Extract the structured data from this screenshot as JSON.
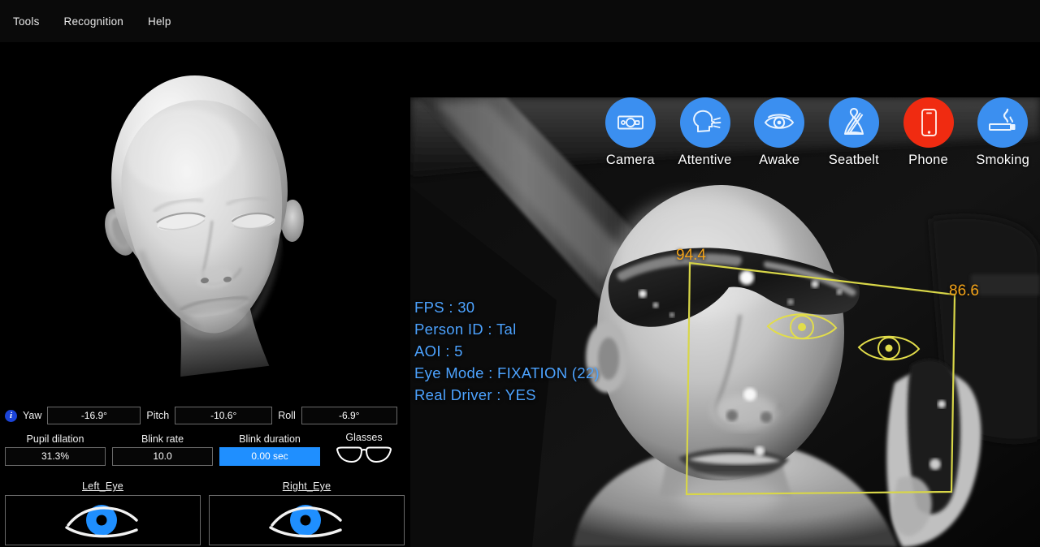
{
  "menu": {
    "items": [
      {
        "label": "Tools",
        "name": "menu-tools"
      },
      {
        "label": "Recognition",
        "name": "menu-recognition"
      },
      {
        "label": "Help",
        "name": "menu-help"
      }
    ]
  },
  "head_model": {
    "title": "3D head pose model",
    "icon": "head-model-3d"
  },
  "pose": {
    "info_icon": "info-icon",
    "info_glyph": "i",
    "yaw_label": "Yaw",
    "yaw_value": "-16.9°",
    "pitch_label": "Pitch",
    "pitch_value": "-10.6°",
    "roll_label": "Roll",
    "roll_value": "-6.9°"
  },
  "stats": {
    "pupil_label": "Pupil dilation",
    "pupil_value": "31.3%",
    "blink_rate_label": "Blink rate",
    "blink_rate_value": "10.0",
    "blink_duration_label": "Blink duration",
    "blink_duration_value": "0.00 sec",
    "blink_duration_highlight_color": "#1f8fff",
    "glasses_label": "Glasses",
    "glasses_icon": "glasses-icon"
  },
  "eyes": {
    "left_label": "Left_Eye",
    "right_label": "Right_Eye",
    "iris_color": "#1f8fff",
    "left_icon": "eye-icon",
    "right_icon": "eye-icon"
  },
  "status_icons": [
    {
      "label": "Camera",
      "name": "status-camera",
      "icon": "camera-icon",
      "color": "#3b8ff0",
      "state": "ok"
    },
    {
      "label": "Attentive",
      "name": "status-attentive",
      "icon": "attentive-head-icon",
      "color": "#3b8ff0",
      "state": "ok"
    },
    {
      "label": "Awake",
      "name": "status-awake",
      "icon": "open-eye-icon",
      "color": "#3b8ff0",
      "state": "ok"
    },
    {
      "label": "Seatbelt",
      "name": "status-seatbelt",
      "icon": "seatbelt-icon",
      "color": "#3b8ff0",
      "state": "ok"
    },
    {
      "label": "Phone",
      "name": "status-phone",
      "icon": "smartphone-icon",
      "color": "#f02b11",
      "state": "alert"
    },
    {
      "label": "Smoking",
      "name": "status-smoking",
      "icon": "cigarette-icon",
      "color": "#3b8ff0",
      "state": "ok"
    }
  ],
  "telemetry": {
    "color": "#4da3ff",
    "lines": [
      "FPS : 30",
      "Person ID : Tal",
      "AOI : 5",
      "Eye Mode : FIXATION (22)",
      "Real Driver : YES"
    ]
  },
  "detection": {
    "box_color": "#d8d648",
    "score_color": "#f4a318",
    "score_left": "94.4",
    "score_right": "86.6",
    "eye_overlay_color": "#e2dd4a"
  }
}
